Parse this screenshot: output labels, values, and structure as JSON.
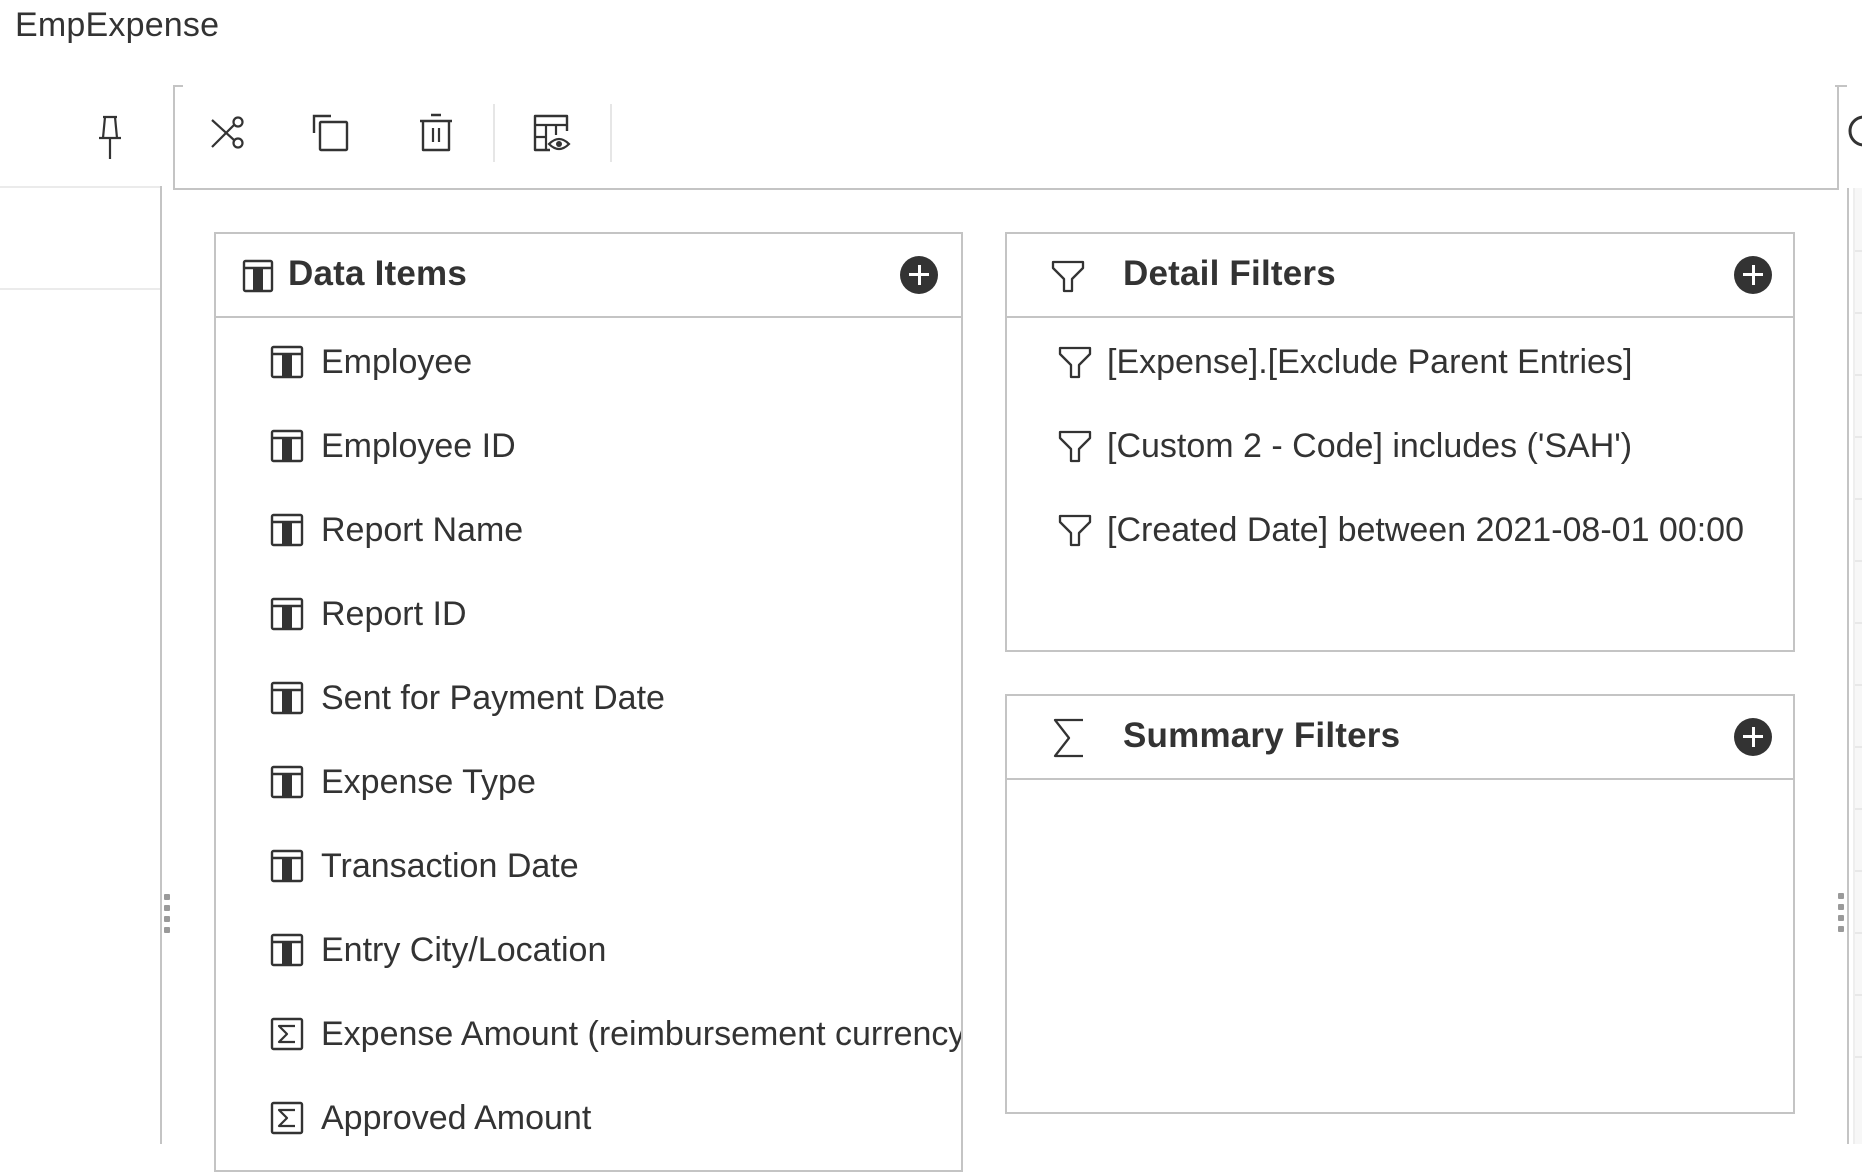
{
  "window": {
    "title": "EmpExpense"
  },
  "toolbar": {
    "buttons": [
      {
        "name": "cut",
        "icon": "scissors-icon",
        "label": "Cut"
      },
      {
        "name": "copy",
        "icon": "copy-icon",
        "label": "Copy"
      },
      {
        "name": "delete",
        "icon": "trash-icon",
        "label": "Delete"
      },
      {
        "name": "view-tabular-data",
        "icon": "table-preview-icon",
        "label": "View tabular data"
      }
    ],
    "pin": {
      "icon": "pin-icon",
      "label": "Pin"
    }
  },
  "panels": {
    "data_items": {
      "title": "Data Items",
      "icon": "table-column-icon",
      "add_label": "Add data item",
      "items": [
        {
          "label": "Employee",
          "type": "attribute"
        },
        {
          "label": "Employee ID",
          "type": "attribute"
        },
        {
          "label": "Report Name",
          "type": "attribute"
        },
        {
          "label": "Report ID",
          "type": "attribute"
        },
        {
          "label": "Sent for Payment Date",
          "type": "attribute"
        },
        {
          "label": "Expense Type",
          "type": "attribute"
        },
        {
          "label": "Transaction Date",
          "type": "attribute"
        },
        {
          "label": "Entry City/Location",
          "type": "attribute"
        },
        {
          "label": "Expense Amount (reimbursement currency)",
          "type": "measure"
        },
        {
          "label": "Approved Amount",
          "type": "measure"
        }
      ]
    },
    "detail_filters": {
      "title": "Detail Filters",
      "icon": "filter-icon",
      "add_label": "Add detail filter",
      "items": [
        {
          "label": "[Expense].[Exclude Parent Entries]"
        },
        {
          "label": "[Custom 2 - Code] includes ('SAH')"
        },
        {
          "label": "[Created Date] between 2021-08-01 00:00"
        }
      ]
    },
    "summary_filters": {
      "title": "Summary Filters",
      "icon": "sigma-icon",
      "add_label": "Add summary filter",
      "items": []
    }
  },
  "colors": {
    "text": "#333333",
    "border": "#c4c4c4",
    "add_button": "#333333"
  }
}
